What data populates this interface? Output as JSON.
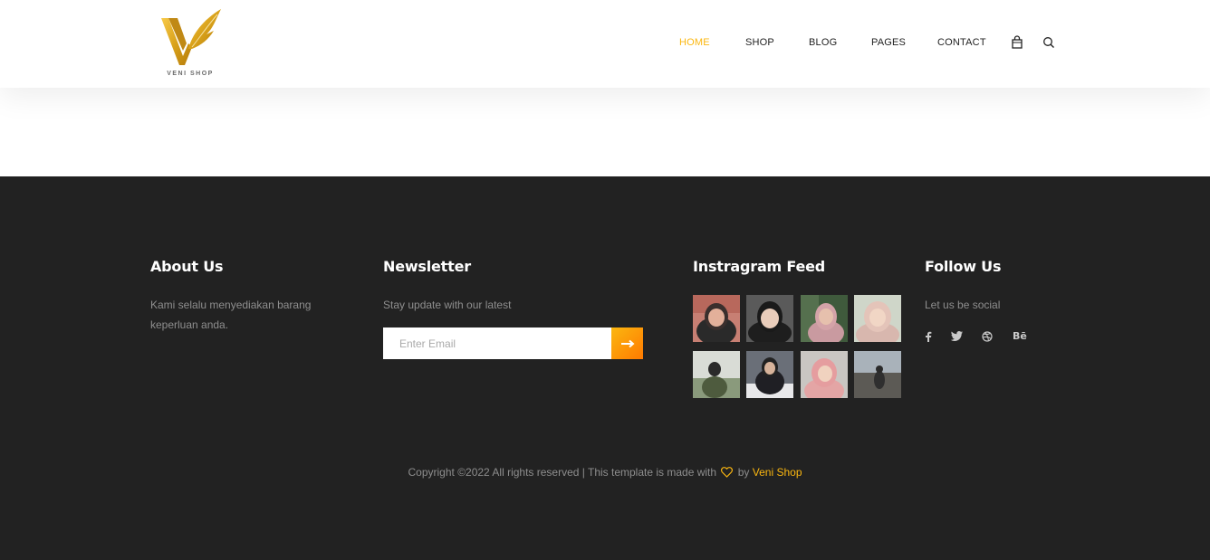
{
  "header": {
    "logo_text": "VENI SHOP",
    "nav": [
      {
        "label": "HOME",
        "active": true
      },
      {
        "label": "SHOP",
        "active": false
      },
      {
        "label": "BLOG",
        "active": false
      },
      {
        "label": "PAGES",
        "active": false
      },
      {
        "label": "CONTACT",
        "active": false
      }
    ],
    "icons": [
      "shopping-bag-icon",
      "search-icon"
    ]
  },
  "footer": {
    "about": {
      "title": "About Us",
      "text_line1": "Kami selalu menyediakan barang",
      "text_line2": "keperluan anda."
    },
    "newsletter": {
      "title": "Newsletter",
      "text": "Stay update with our latest",
      "placeholder": "Enter Email",
      "button_icon": "arrow-right-icon"
    },
    "instagram": {
      "title": "Instragram Feed",
      "images": [
        "instagram-photo-1",
        "instagram-photo-2",
        "instagram-photo-3",
        "instagram-photo-4",
        "instagram-photo-5",
        "instagram-photo-6",
        "instagram-photo-7",
        "instagram-photo-8"
      ]
    },
    "follow": {
      "title": "Follow Us",
      "text": "Let us be social",
      "socials": [
        "facebook-icon",
        "twitter-icon",
        "dribbble-icon",
        "behance-icon"
      ],
      "behance_text": "Bē"
    },
    "copyright": {
      "prefix": "Copyright ©2022 All rights reserved | This template is made with",
      "by": "by",
      "brand": "Veni Shop"
    }
  },
  "colors": {
    "accent": "#fbb710",
    "footer_bg": "#222222",
    "header_bg": "#ffffff"
  }
}
